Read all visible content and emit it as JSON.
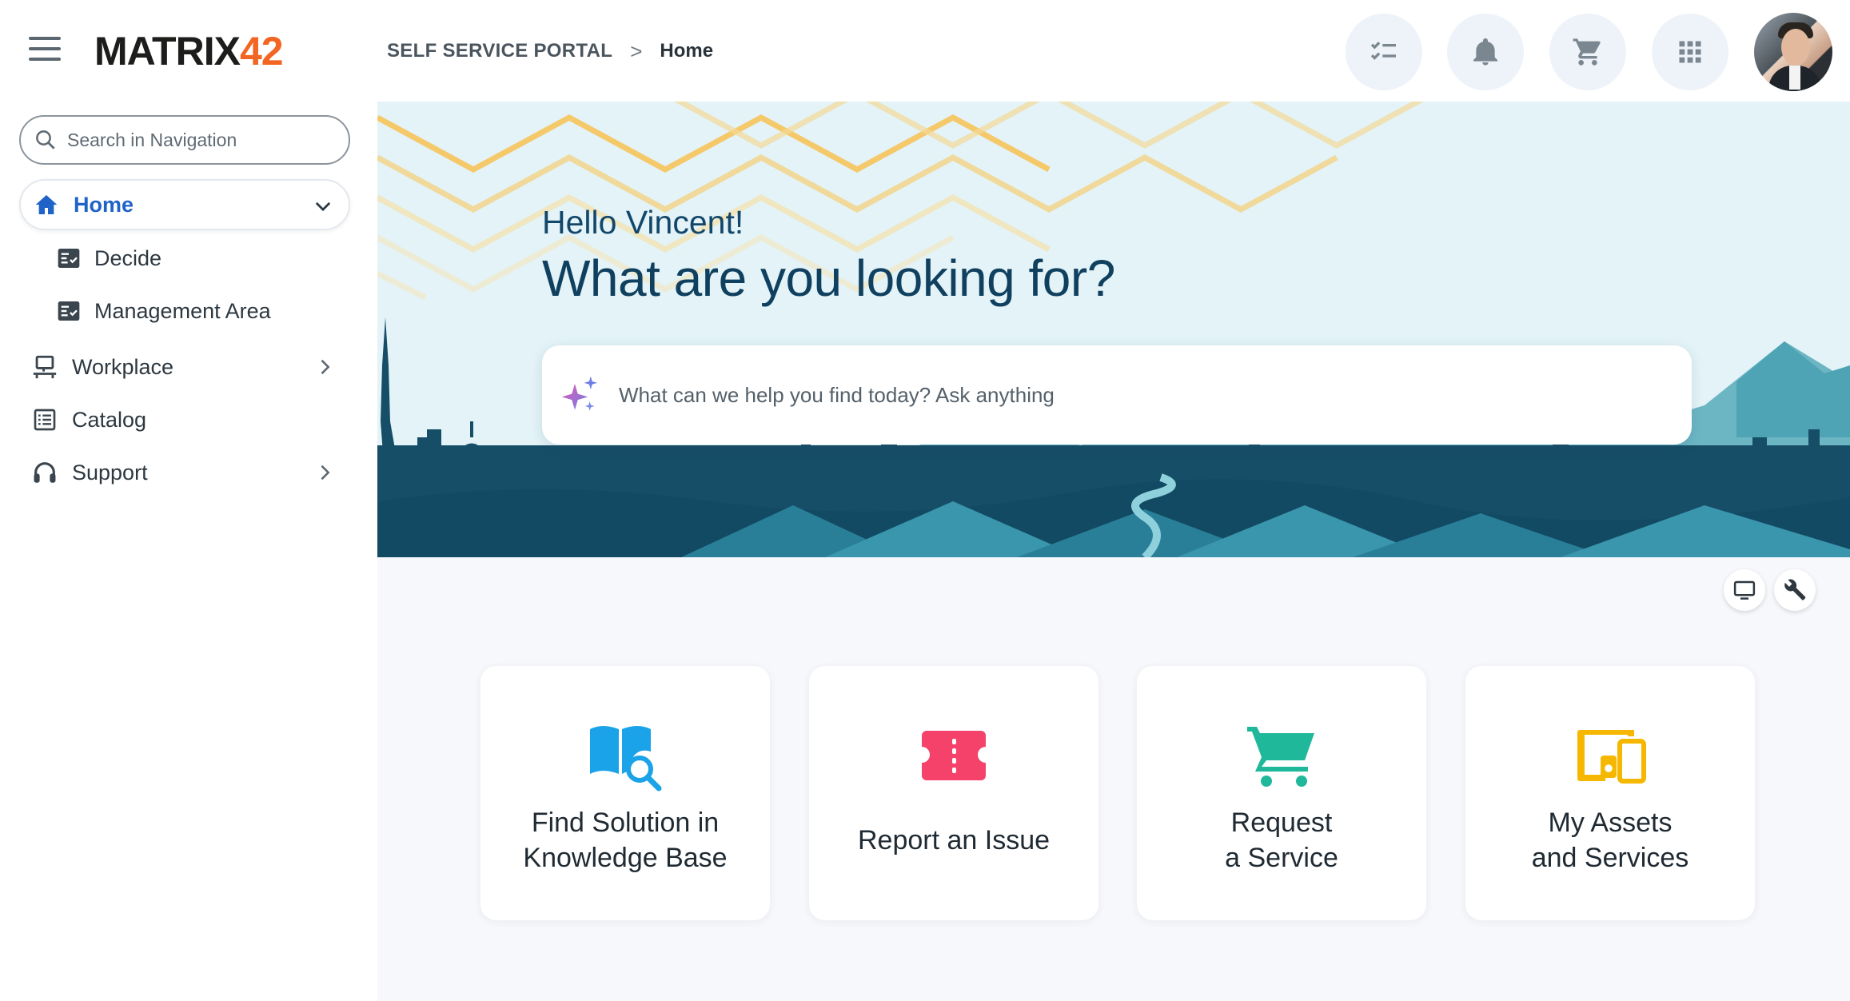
{
  "app": {
    "logo_text": "MATRIX",
    "logo_number": "42",
    "brand_color": "#f26522"
  },
  "header": {
    "breadcrumb": {
      "root": "SELF SERVICE PORTAL",
      "separator": ">",
      "current": "Home"
    },
    "icons": [
      "task-list-icon",
      "bell-icon",
      "cart-icon",
      "apps-grid-icon"
    ]
  },
  "sidebar": {
    "search_placeholder": "Search in Navigation",
    "home_label": "Home",
    "sub_items": [
      {
        "label": "Decide",
        "icon": "checklist-icon"
      },
      {
        "label": "Management Area",
        "icon": "checklist-icon"
      }
    ],
    "items": [
      {
        "label": "Workplace",
        "icon": "workplace-icon"
      },
      {
        "label": "Catalog",
        "icon": "catalog-icon"
      },
      {
        "label": "Support",
        "icon": "headset-icon"
      }
    ],
    "accent_color": "#1f63c8"
  },
  "hero": {
    "greeting": "Hello Vincent!",
    "headline": "What are you looking for?",
    "ask_placeholder": "What can we help you find today? Ask anything"
  },
  "tiles": [
    {
      "label": "Find Solution in\nKnowledge Base",
      "icon": "knowledge-book-icon",
      "color": "#1aa3e8"
    },
    {
      "label": "Report an Issue",
      "icon": "ticket-icon",
      "color": "#f4426b"
    },
    {
      "label": "Request\na Service",
      "icon": "shopping-cart-icon",
      "color": "#1fb89a"
    },
    {
      "label": "My Assets\nand Services",
      "icon": "devices-icon",
      "color": "#f5b700"
    }
  ]
}
